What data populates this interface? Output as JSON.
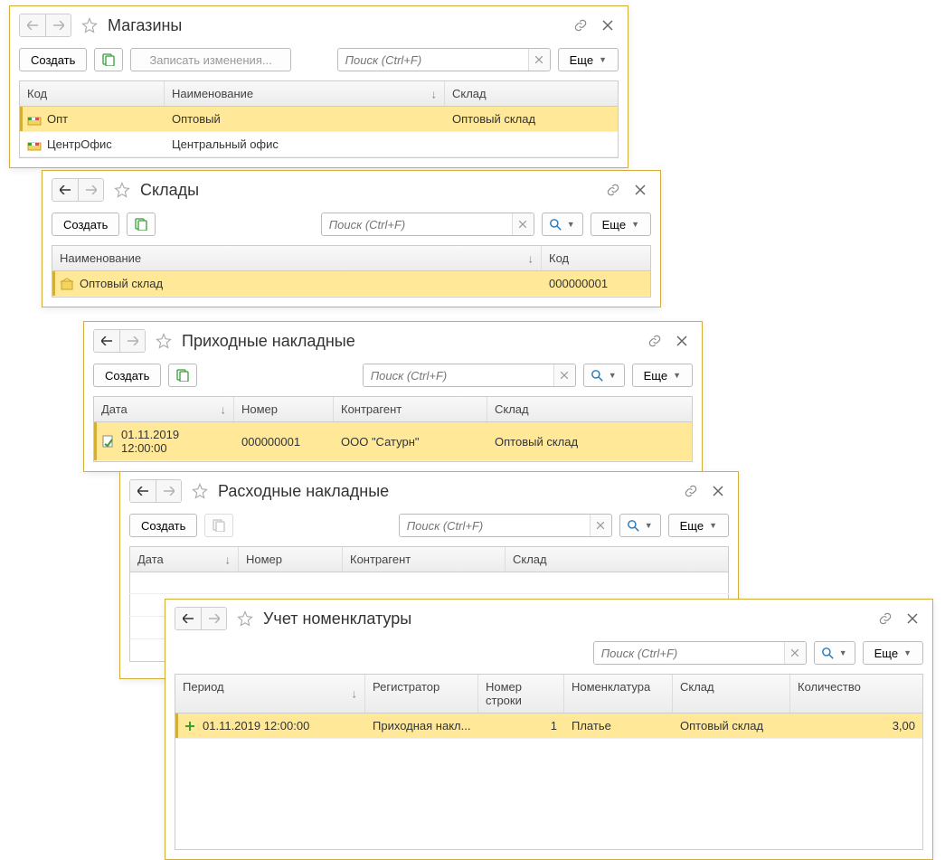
{
  "common": {
    "create": "Создать",
    "more": "Еще",
    "search_placeholder": "Поиск (Ctrl+F)"
  },
  "w1": {
    "title": "Магазины",
    "save_changes": "Записать изменения...",
    "cols": {
      "code": "Код",
      "name": "Наименование",
      "warehouse": "Склад"
    },
    "rows": [
      {
        "code": "Опт",
        "name": "Оптовый",
        "warehouse": "Оптовый склад",
        "selected": true
      },
      {
        "code": "ЦентрОфис",
        "name": "Центральный офис",
        "warehouse": "",
        "selected": false
      }
    ]
  },
  "w2": {
    "title": "Склады",
    "cols": {
      "name": "Наименование",
      "code": "Код"
    },
    "rows": [
      {
        "name": "Оптовый склад",
        "code": "000000001",
        "selected": true
      }
    ]
  },
  "w3": {
    "title": "Приходные накладные",
    "cols": {
      "date": "Дата",
      "number": "Номер",
      "counterparty": "Контрагент",
      "warehouse": "Склад"
    },
    "rows": [
      {
        "date": "01.11.2019 12:00:00",
        "number": "000000001",
        "counterparty": "ООО \"Сатурн\"",
        "warehouse": "Оптовый склад",
        "selected": true
      }
    ]
  },
  "w4": {
    "title": "Расходные накладные",
    "cols": {
      "date": "Дата",
      "number": "Номер",
      "counterparty": "Контрагент",
      "warehouse": "Склад"
    }
  },
  "w5": {
    "title": "Учет номенклатуры",
    "cols": {
      "period": "Период",
      "registrar": "Регистратор",
      "lineno": "Номер строки",
      "item": "Номенклатура",
      "warehouse": "Склад",
      "qty": "Количество"
    },
    "rows": [
      {
        "period": "01.11.2019 12:00:00",
        "registrar": "Приходная накл...",
        "lineno": "1",
        "item": "Платье",
        "warehouse": "Оптовый склад",
        "qty": "3,00",
        "selected": true
      }
    ]
  }
}
